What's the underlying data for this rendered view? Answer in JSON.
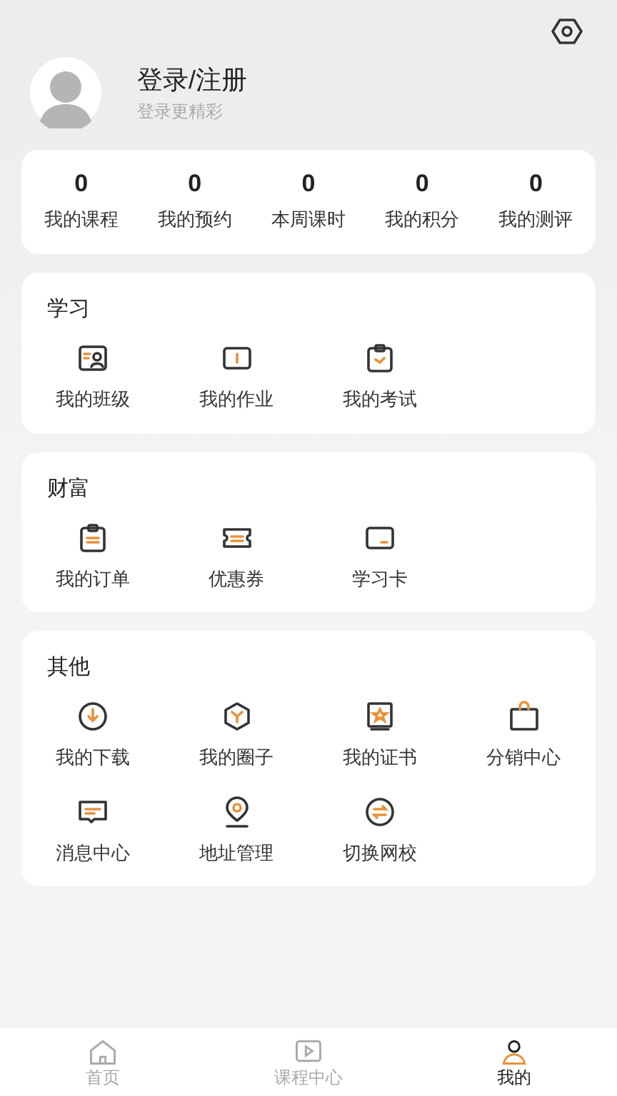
{
  "profile": {
    "name": "登录/注册",
    "subtitle": "登录更精彩"
  },
  "stats": [
    {
      "value": "0",
      "label": "我的课程"
    },
    {
      "value": "0",
      "label": "我的预约"
    },
    {
      "value": "0",
      "label": "本周课时"
    },
    {
      "value": "0",
      "label": "我的积分"
    },
    {
      "value": "0",
      "label": "我的测评"
    }
  ],
  "sections": [
    {
      "title": "学习",
      "items": [
        "我的班级",
        "我的作业",
        "我的考试"
      ]
    },
    {
      "title": "财富",
      "items": [
        "我的订单",
        "优惠券",
        "学习卡"
      ]
    },
    {
      "title": "其他",
      "items": [
        "我的下载",
        "我的圈子",
        "我的证书",
        "分销中心",
        "消息中心",
        "地址管理",
        "切换网校"
      ]
    }
  ],
  "tabs": [
    {
      "label": "首页",
      "selected": false
    },
    {
      "label": "课程中心",
      "selected": false
    },
    {
      "label": "我的",
      "selected": true
    }
  ]
}
